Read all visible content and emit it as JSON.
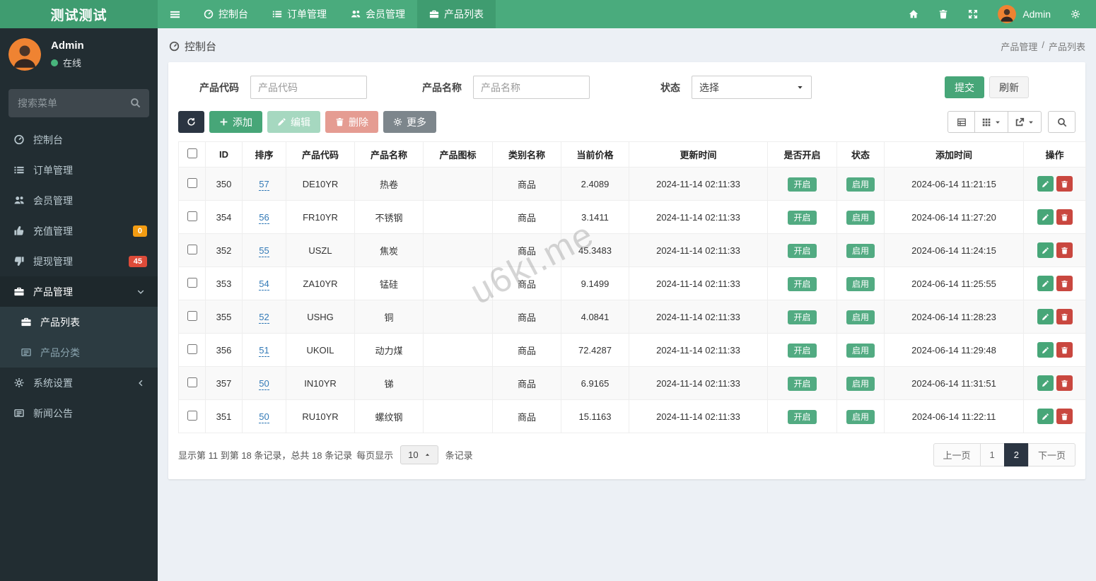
{
  "navbar": {
    "brand": "测试测试",
    "tabs": [
      {
        "label": "控制台",
        "icon": "dashboard-icon"
      },
      {
        "label": "订单管理",
        "icon": "list-icon"
      },
      {
        "label": "会员管理",
        "icon": "users-icon"
      },
      {
        "label": "产品列表",
        "icon": "briefcase-icon",
        "active": true
      }
    ],
    "user": "Admin"
  },
  "sidebar": {
    "user": {
      "name": "Admin",
      "status": "在线"
    },
    "search_placeholder": "搜索菜单",
    "items": [
      {
        "label": "控制台"
      },
      {
        "label": "订单管理"
      },
      {
        "label": "会员管理"
      },
      {
        "label": "充值管理",
        "badge": "0"
      },
      {
        "label": "提现管理",
        "badge": "45"
      },
      {
        "label": "产品管理"
      },
      {
        "label": "产品列表"
      },
      {
        "label": "产品分类"
      },
      {
        "label": "系统设置"
      },
      {
        "label": "新闻公告"
      }
    ]
  },
  "content_header": {
    "title": "控制台",
    "breadcrumb": {
      "parent": "产品管理",
      "separator": "/",
      "current": "产品列表"
    }
  },
  "filters": {
    "code_label": "产品代码",
    "code_placeholder": "产品代码",
    "name_label": "产品名称",
    "name_placeholder": "产品名称",
    "status_label": "状态",
    "status_value": "选择",
    "submit_label": "提交",
    "refresh_label": "刷新"
  },
  "toolbar": {
    "add_label": "添加",
    "edit_label": "编辑",
    "delete_label": "删除",
    "more_label": "更多"
  },
  "table": {
    "headers": [
      "ID",
      "排序",
      "产品代码",
      "产品名称",
      "产品图标",
      "类别名称",
      "当前价格",
      "更新时间",
      "是否开启",
      "状态",
      "添加时间",
      "操作"
    ],
    "open_label": "开启",
    "status_label": "启用",
    "rows": [
      {
        "id": "350",
        "sort": "57",
        "code": "DE10YR",
        "name": "热卷",
        "category": "商品",
        "price": "2.4089",
        "updated": "2024-11-14 02:11:33",
        "added": "2024-06-14 11:21:15"
      },
      {
        "id": "354",
        "sort": "56",
        "code": "FR10YR",
        "name": "不锈钢",
        "category": "商品",
        "price": "3.1411",
        "updated": "2024-11-14 02:11:33",
        "added": "2024-06-14 11:27:20"
      },
      {
        "id": "352",
        "sort": "55",
        "code": "USZL",
        "name": "焦炭",
        "category": "商品",
        "price": "45.3483",
        "updated": "2024-11-14 02:11:33",
        "added": "2024-06-14 11:24:15"
      },
      {
        "id": "353",
        "sort": "54",
        "code": "ZA10YR",
        "name": "锰硅",
        "category": "商品",
        "price": "9.1499",
        "updated": "2024-11-14 02:11:33",
        "added": "2024-06-14 11:25:55"
      },
      {
        "id": "355",
        "sort": "52",
        "code": "USHG",
        "name": "铜",
        "category": "商品",
        "price": "4.0841",
        "updated": "2024-11-14 02:11:33",
        "added": "2024-06-14 11:28:23"
      },
      {
        "id": "356",
        "sort": "51",
        "code": "UKOIL",
        "name": "动力煤",
        "category": "商品",
        "price": "72.4287",
        "updated": "2024-11-14 02:11:33",
        "added": "2024-06-14 11:29:48"
      },
      {
        "id": "357",
        "sort": "50",
        "code": "IN10YR",
        "name": "锑",
        "category": "商品",
        "price": "6.9165",
        "updated": "2024-11-14 02:11:33",
        "added": "2024-06-14 11:31:51"
      },
      {
        "id": "351",
        "sort": "50",
        "code": "RU10YR",
        "name": "螺纹钢",
        "category": "商品",
        "price": "15.1163",
        "updated": "2024-11-14 02:11:33",
        "added": "2024-06-14 11:22:11"
      }
    ]
  },
  "pagination": {
    "info": "显示第 11 到第 18 条记录，总共 18 条记录",
    "per_page_label": "每页显示",
    "page_size": "10",
    "records_label": "条记录",
    "prev_label": "上一页",
    "pages": [
      "1",
      "2"
    ],
    "active_page": "2",
    "next_label": "下一页"
  },
  "watermark": "u6ki.me",
  "colors": {
    "navbar_green": "#4aab7d",
    "navbar_dark_green": "#3f9c70",
    "sidebar_dark": "#222d32",
    "badge_green": "#52ab82",
    "badge_orange": "#f39c12",
    "badge_red": "#dd4b39",
    "button_green": "#47a678",
    "button_dark": "#2b3542",
    "delete_red": "#c9473f",
    "link_blue": "#337ab7"
  }
}
